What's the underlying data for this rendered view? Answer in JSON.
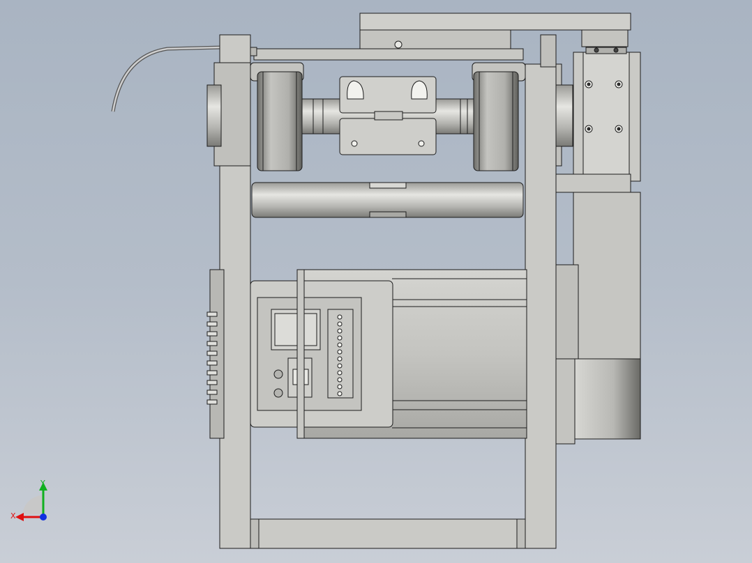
{
  "viewport": {
    "background_top": "#a9b4c2",
    "background_bottom": "#c9ced6"
  },
  "model": {
    "description_icon": "cad-assembly",
    "part_fill": "#c8c8c4",
    "part_fill_light": "#d8d8d4",
    "part_fill_dark": "#8c8c88",
    "edge_color": "#1c1c1c"
  },
  "triad": {
    "x_label": "X",
    "y_label": "Y",
    "x_color": "#e01010",
    "y_color": "#10b020",
    "z_color": "#1030e0"
  }
}
